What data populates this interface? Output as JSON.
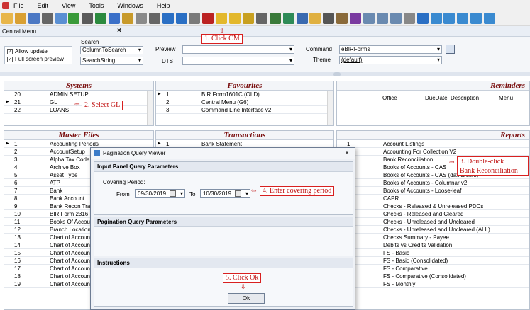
{
  "menu": [
    "File",
    "Edit",
    "View",
    "Tools",
    "Windows",
    "Help"
  ],
  "central_menu": {
    "title": "Central Menu",
    "close": "×"
  },
  "criteria": {
    "allow_update": "Allow update",
    "full_screen_preview": "Full screen preview",
    "search_label": "Search",
    "search_field": "ColumnToSearch",
    "search_string": "SearchString",
    "preview_label": "Preview",
    "dts_label": "DTS",
    "command_label": "Command",
    "command_value": "eBIRForms",
    "theme_label": "Theme",
    "theme_value": "(default)"
  },
  "systems": {
    "title": "Systems",
    "rows": [
      {
        "num": "20",
        "name": "ADMIN SETUP"
      },
      {
        "num": "21",
        "name": "GL"
      },
      {
        "num": "22",
        "name": "LOANS"
      }
    ]
  },
  "favourites": {
    "title": "Favourites",
    "rows": [
      {
        "num": "1",
        "name": "BIR Form1601C (OLD)"
      },
      {
        "num": "2",
        "name": "Central Menu (G6)"
      },
      {
        "num": "3",
        "name": "Command Line Interface v2"
      }
    ]
  },
  "reminders": {
    "title": "Reminders",
    "columns": [
      "Office",
      "DueDate",
      "Description",
      "Menu"
    ]
  },
  "master_files": {
    "title": "Master Files",
    "rows": [
      {
        "num": "1",
        "name": "Accounting Periods"
      },
      {
        "num": "2",
        "name": "AccountSetup"
      },
      {
        "num": "3",
        "name": "Alpha Tax Code"
      },
      {
        "num": "4",
        "name": "Archive Box"
      },
      {
        "num": "5",
        "name": "Asset Type"
      },
      {
        "num": "6",
        "name": "ATP"
      },
      {
        "num": "7",
        "name": "Bank"
      },
      {
        "num": "8",
        "name": "Bank Account"
      },
      {
        "num": "9",
        "name": "Bank Recon Tra"
      },
      {
        "num": "10",
        "name": "BIR Form 2316"
      },
      {
        "num": "11",
        "name": "Books Of Accou"
      },
      {
        "num": "12",
        "name": "Branch Location"
      },
      {
        "num": "13",
        "name": "Chart of Accoun"
      },
      {
        "num": "14",
        "name": "Chart of Accoun"
      },
      {
        "num": "15",
        "name": "Chart of Accoun"
      },
      {
        "num": "16",
        "name": "Chart of Accoun"
      },
      {
        "num": "17",
        "name": "Chart of Accoun"
      },
      {
        "num": "18",
        "name": "Chart of Accoun"
      },
      {
        "num": "19",
        "name": "Chart of Accoun"
      }
    ]
  },
  "transactions": {
    "title": "Transactions",
    "rows": [
      {
        "num": "1",
        "name": "Bank Statement"
      },
      {
        "num": "2",
        "name": "Billing and Collection"
      }
    ]
  },
  "reports": {
    "title": "Reports",
    "rows": [
      {
        "num": "1",
        "name": "Account Listings"
      },
      {
        "num": "",
        "name": "Accounting For Collection V2"
      },
      {
        "num": "",
        "name": "Bank Reconciliation"
      },
      {
        "num": "",
        "name": "Books of Accounts - CAS"
      },
      {
        "num": "",
        "name": "Books of Accounts - CAS (dax & ssrs)"
      },
      {
        "num": "",
        "name": "Books of Accounts - Columnar v2"
      },
      {
        "num": "",
        "name": "Books of Accounts - Loose-leaf"
      },
      {
        "num": "",
        "name": "CAPR"
      },
      {
        "num": "",
        "name": "Checks - Released & Unreleased PDCs"
      },
      {
        "num": "",
        "name": "Checks - Released and Cleared"
      },
      {
        "num": "",
        "name": "Checks - Unreleased and Uncleared"
      },
      {
        "num": "",
        "name": "Checks - Unreleased and Uncleared (ALL)"
      },
      {
        "num": "",
        "name": "Checks Summary - Payee"
      },
      {
        "num": "",
        "name": "Debits vs Credits Validation"
      },
      {
        "num": "",
        "name": "FS - Basic"
      },
      {
        "num": "",
        "name": "FS - Basic (Consolidated)"
      },
      {
        "num": "",
        "name": "FS - Comparative"
      },
      {
        "num": "",
        "name": "FS - Comparative (Consolidated)"
      },
      {
        "num": "",
        "name": "FS - Monthly"
      }
    ]
  },
  "dialog": {
    "title": "Pagination Query Viewer",
    "close": "×",
    "input_panel": "Input Panel Query Parameters",
    "covering_period": "Covering Period:",
    "from_label": "From",
    "from_value": "09/30/2019",
    "to_label": "To",
    "to_value": "10/30/2019",
    "pagination_panel": "Pagination Query Parameters",
    "instructions": "Instructions",
    "ok": "Ok"
  },
  "callouts": {
    "c1": "1. Click CM",
    "c2": "2. Select GL",
    "c3a": "3. Double-click",
    "c3b": "Bank Reconciliation",
    "c4": "4. Enter covering period",
    "c5": "5. Click Ok"
  },
  "colors": {
    "callout": "#c01010",
    "panel_title": "#7a1010"
  },
  "toolbar_icons": [
    "new",
    "open",
    "save",
    "print",
    "preview",
    "up",
    "csv",
    "refresh",
    "undo",
    "find",
    "doc",
    "grid",
    "help",
    "info",
    "calc",
    "cm",
    "star",
    "star-plus",
    "gl",
    "hammer",
    "flag",
    "excel",
    "monitor",
    "folder",
    "db",
    "key",
    "wand",
    "zoom-out",
    "zoom-in",
    "zoom-fit",
    "table",
    "info2",
    "filter",
    "filter-x",
    "filter-y",
    "funnel",
    "sort"
  ]
}
